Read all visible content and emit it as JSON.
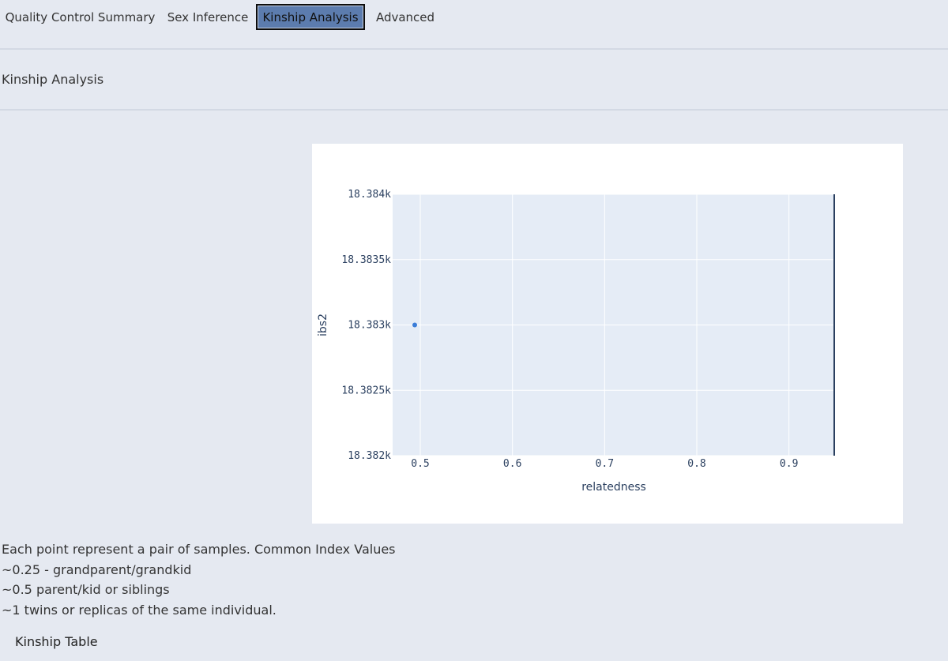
{
  "tabs": [
    {
      "label": "Quality Control Summary",
      "active": false
    },
    {
      "label": "Sex Inference",
      "active": false
    },
    {
      "label": "Kinship Analysis",
      "active": true
    },
    {
      "label": "Advanced",
      "active": false
    }
  ],
  "section_title": "Kinship Analysis",
  "notes": [
    "Each point represent a pair of samples. Common Index Values",
    "~0.25 - grandparent/grandkid",
    "~0.5 parent/kid or siblings",
    "~1 twins or replicas of the same individual."
  ],
  "kinship_table_title": "Kinship Table",
  "colors": {
    "plot_bg": "#e5ecf6",
    "grid": "#ffffff",
    "point": "#3b7dd8",
    "axis_text": "#2a3f5f",
    "active_tab": "#5c7cae"
  },
  "chart_data": {
    "type": "scatter",
    "xlabel": "relatedness",
    "ylabel": "ibs2",
    "xlim": [
      0.47,
      0.95
    ],
    "ylim": [
      18382,
      18384
    ],
    "x_ticks": [
      0.5,
      0.6,
      0.7,
      0.8,
      0.9
    ],
    "x_tick_labels": [
      "0.5",
      "0.6",
      "0.7",
      "0.8",
      "0.9"
    ],
    "y_ticks": [
      18382,
      18382.5,
      18383,
      18383.5,
      18384
    ],
    "y_tick_labels": [
      "18.382k",
      "18.3825k",
      "18.383k",
      "18.3835k",
      "18.384k"
    ],
    "grid": true,
    "points": [
      {
        "x": 0.494,
        "y": 18383
      }
    ]
  }
}
